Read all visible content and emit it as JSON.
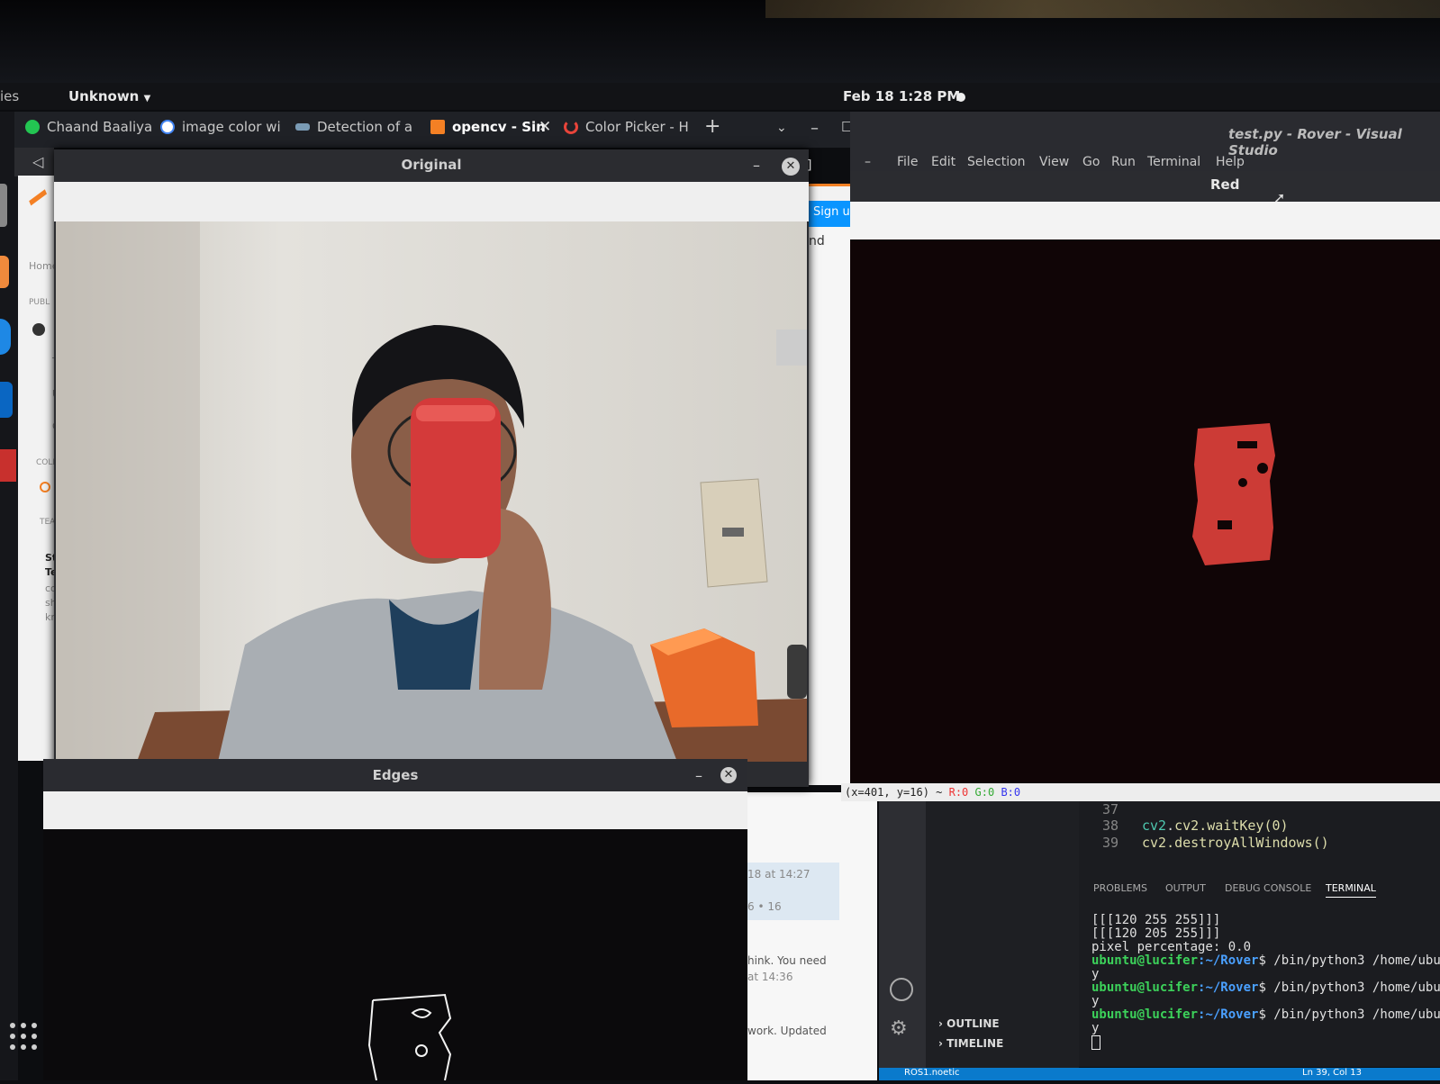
{
  "topbar": {
    "left_fragment": "ies",
    "network_label": "Unknown",
    "datetime": "Feb 18  1:28 PM"
  },
  "browser": {
    "tabs": [
      {
        "label": "Chaand Baaliya",
        "color": "#23c552"
      },
      {
        "label": "image color wi",
        "color": "#4285f4"
      },
      {
        "label": "Detection of a",
        "color": "#7a9bb5"
      },
      {
        "label": "opencv - Sin",
        "color": "#f48024"
      },
      {
        "label": "Color Picker - H",
        "color": "#e8443a"
      }
    ],
    "new_tab": "+"
  },
  "so_page": {
    "left_texts": [
      "Home",
      "PUBL",
      "T",
      "U",
      "C",
      "COLL",
      "E",
      "TEAM",
      "Stac",
      "Tea",
      "colla",
      "shar",
      "know"
    ],
    "signup": "Sign u",
    "fragment_nd": "nd",
    "comment_time_1": "18 at 14:27",
    "votes": "6  • 16",
    "text_1": "hink. You need",
    "time_2": "at 14:36",
    "text_2": "work. Updated"
  },
  "original_window": {
    "title": "Original"
  },
  "red_window": {
    "title": "Red",
    "status": "(x=401, y=16) ~",
    "status_r": "R:0",
    "status_g": "G:0",
    "status_b": "B:0"
  },
  "edges_window": {
    "title": "Edges"
  },
  "vscode": {
    "title": "test.py - Rover - Visual Studio",
    "menu": [
      "File",
      "Edit",
      "Selection",
      "View",
      "Go",
      "Run",
      "Terminal",
      "Help"
    ],
    "code_lines": [
      {
        "num": "37",
        "code": ""
      },
      {
        "num": "38",
        "code": "cv2.waitKey(0)"
      },
      {
        "num": "39",
        "code": "cv2.destroyAllWindows()"
      }
    ],
    "panel_tabs": [
      "PROBLEMS",
      "OUTPUT",
      "DEBUG CONSOLE",
      "TERMINAL"
    ],
    "terminal": {
      "out1": "[[[120 255 255]]]",
      "out2": "[[[120 205 255]]]",
      "out3": "pixel percentage: 0.0",
      "user": "ubuntu@lucifer",
      "path": ":~/Rover",
      "cmd": "$ /bin/python3 /home/ubu",
      "y": "y"
    },
    "sidebar_sections": [
      "OUTLINE",
      "TIMELINE"
    ],
    "status_left": "ROS1.noetic",
    "status_right": "Ln 39, Col 13"
  }
}
